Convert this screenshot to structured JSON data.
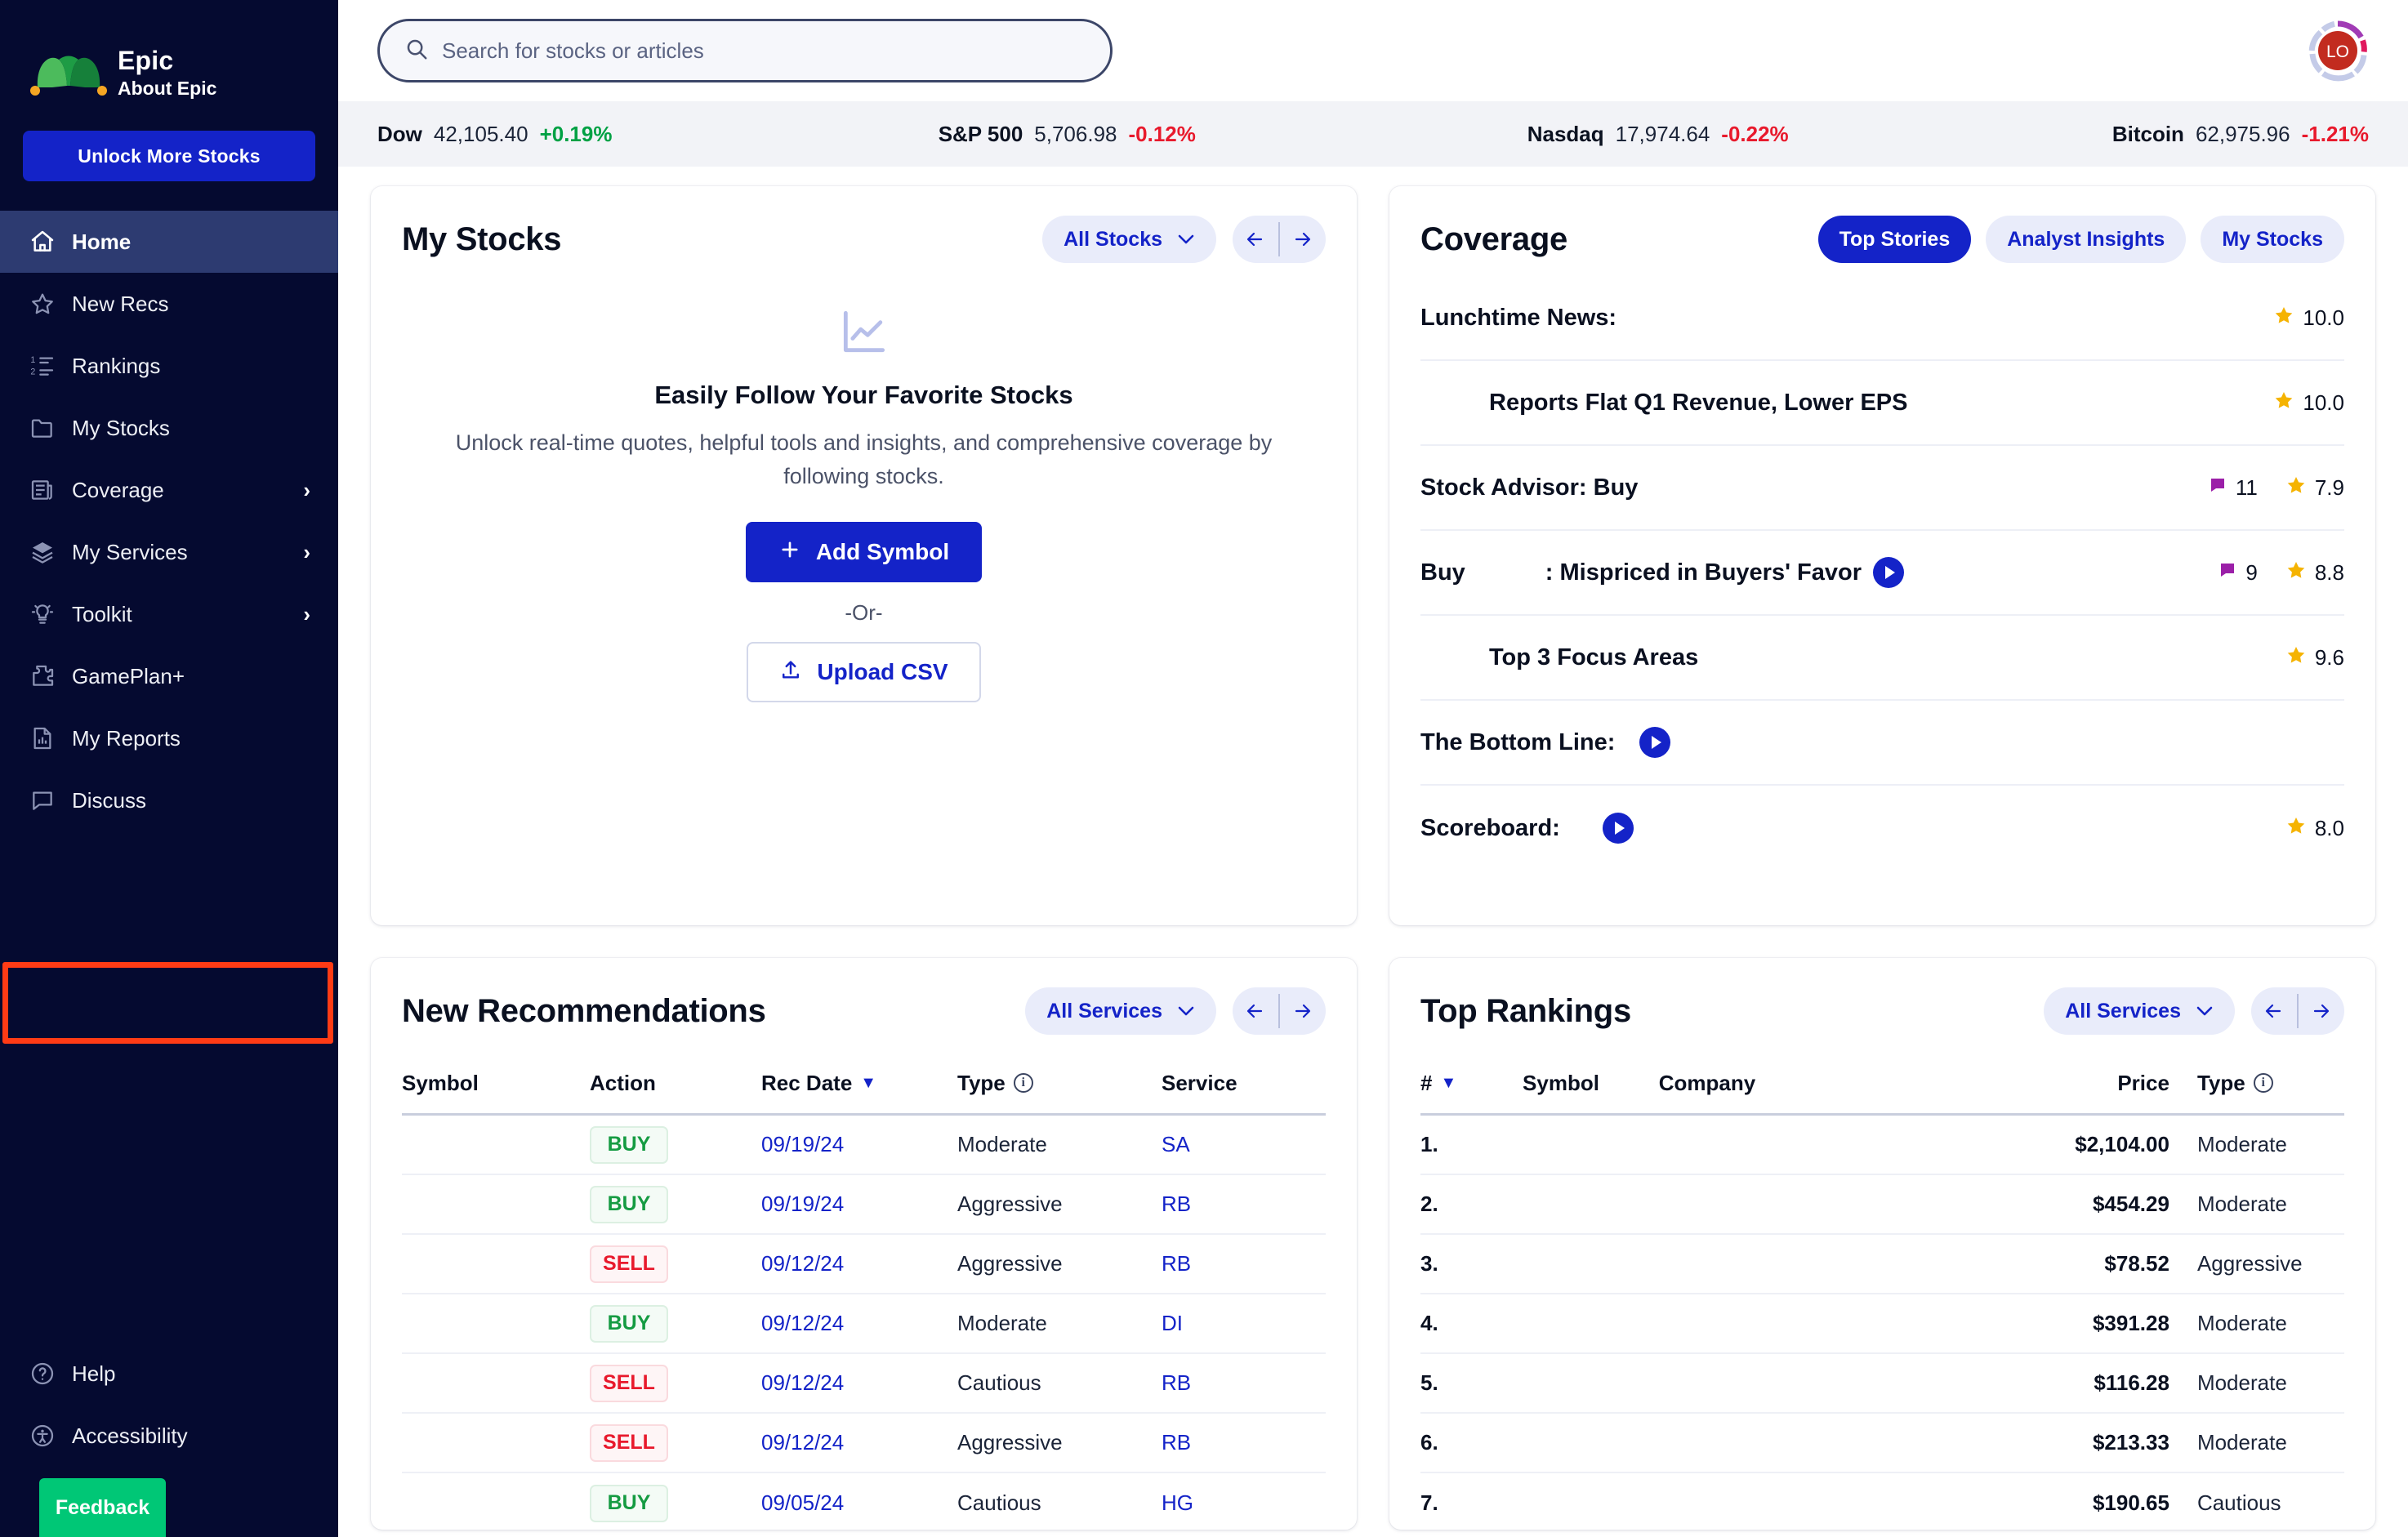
{
  "brand": {
    "title": "Epic",
    "subtitle": "About Epic",
    "logo_icon": "jester-hat-logo"
  },
  "sidebar": {
    "unlock_label": "Unlock More Stocks",
    "feedback_label": "Feedback",
    "items": [
      {
        "label": "Home",
        "icon": "home-icon",
        "active": true,
        "chevron": false
      },
      {
        "label": "New Recs",
        "icon": "star-icon",
        "active": false,
        "chevron": false
      },
      {
        "label": "Rankings",
        "icon": "ordered-list-icon",
        "active": false,
        "chevron": false
      },
      {
        "label": "My Stocks",
        "icon": "folder-icon",
        "active": false,
        "chevron": false
      },
      {
        "label": "Coverage",
        "icon": "news-icon",
        "active": false,
        "chevron": true
      },
      {
        "label": "My Services",
        "icon": "layers-icon",
        "active": false,
        "chevron": true
      },
      {
        "label": "Toolkit",
        "icon": "lightbulb-icon",
        "active": false,
        "chevron": true
      },
      {
        "label": "GamePlan+",
        "icon": "puzzle-icon",
        "active": false,
        "chevron": false
      },
      {
        "label": "My Reports",
        "icon": "report-icon",
        "active": false,
        "chevron": false
      },
      {
        "label": "Discuss",
        "icon": "chat-icon",
        "active": false,
        "chevron": false
      }
    ],
    "bottom_items": [
      {
        "label": "Help",
        "icon": "question-circle-icon"
      },
      {
        "label": "Accessibility",
        "icon": "accessibility-icon"
      }
    ],
    "highlight_target": "My Services",
    "highlight_color": "#FF3B15"
  },
  "topbar": {
    "search_placeholder": "Search for stocks or articles",
    "search_value": "",
    "avatar_initials": "LO"
  },
  "ticker": [
    {
      "name": "Dow",
      "value": "42,105.40",
      "change": "+0.19%",
      "dir": "up"
    },
    {
      "name": "S&P 500",
      "value": "5,706.98",
      "change": "-0.12%",
      "dir": "down"
    },
    {
      "name": "Nasdaq",
      "value": "17,974.64",
      "change": "-0.22%",
      "dir": "down"
    },
    {
      "name": "Bitcoin",
      "value": "62,975.96",
      "change": "-1.21%",
      "dir": "down"
    }
  ],
  "my_stocks": {
    "title": "My Stocks",
    "filter_label": "All Stocks",
    "empty_title": "Easily Follow Your Favorite Stocks",
    "empty_desc": "Unlock real-time quotes, helpful tools and insights, and comprehensive coverage by following stocks.",
    "add_symbol_label": "Add Symbol",
    "or_label": "-Or-",
    "upload_label": "Upload CSV"
  },
  "coverage": {
    "title": "Coverage",
    "tabs": [
      {
        "label": "Top Stories",
        "active": true
      },
      {
        "label": "Analyst Insights",
        "active": false
      },
      {
        "label": "My Stocks",
        "active": false
      }
    ],
    "rows": [
      {
        "label": "Lunchtime News:",
        "mid": "",
        "indent": false,
        "play": false,
        "comments": "",
        "rating": "10.0"
      },
      {
        "label": "",
        "mid": "Reports Flat Q1 Revenue, Lower EPS",
        "indent": true,
        "play": false,
        "comments": "",
        "rating": "10.0"
      },
      {
        "label": "Stock Advisor: Buy",
        "mid": "",
        "indent": false,
        "play": false,
        "comments": "11",
        "rating": "7.9"
      },
      {
        "label": "Buy",
        "mid": ": Mispriced in Buyers' Favor",
        "indent": false,
        "play": true,
        "comments": "9",
        "rating": "8.8"
      },
      {
        "label": "",
        "mid": "Top 3 Focus Areas",
        "indent": true,
        "play": false,
        "comments": "",
        "rating": "9.6"
      },
      {
        "label": "The Bottom Line:",
        "mid": "",
        "indent": false,
        "play": true,
        "comments": "",
        "rating": ""
      },
      {
        "label": "Scoreboard:",
        "mid": "",
        "indent": false,
        "play": true,
        "comments": "",
        "rating": "8.0"
      }
    ]
  },
  "new_recommendations": {
    "title": "New Recommendations",
    "filter_label": "All Services",
    "columns": [
      "Symbol",
      "Action",
      "Rec Date",
      "Type",
      "Service"
    ],
    "sorted_column": "Rec Date",
    "rows": [
      {
        "symbol": "",
        "action": "BUY",
        "date": "09/19/24",
        "type": "Moderate",
        "service": "SA"
      },
      {
        "symbol": "",
        "action": "BUY",
        "date": "09/19/24",
        "type": "Aggressive",
        "service": "RB"
      },
      {
        "symbol": "",
        "action": "SELL",
        "date": "09/12/24",
        "type": "Aggressive",
        "service": "RB"
      },
      {
        "symbol": "",
        "action": "BUY",
        "date": "09/12/24",
        "type": "Moderate",
        "service": "DI"
      },
      {
        "symbol": "",
        "action": "SELL",
        "date": "09/12/24",
        "type": "Cautious",
        "service": "RB"
      },
      {
        "symbol": "",
        "action": "SELL",
        "date": "09/12/24",
        "type": "Aggressive",
        "service": "RB"
      },
      {
        "symbol": "",
        "action": "BUY",
        "date": "09/05/24",
        "type": "Cautious",
        "service": "HG"
      }
    ]
  },
  "top_rankings": {
    "title": "Top Rankings",
    "filter_label": "All Services",
    "columns": [
      "#",
      "Symbol",
      "Company",
      "Price",
      "Type"
    ],
    "sorted_column": "#",
    "rows": [
      {
        "rank": "1.",
        "symbol": "",
        "company": "",
        "price": "$2,104.00",
        "type": "Moderate"
      },
      {
        "rank": "2.",
        "symbol": "",
        "company": "",
        "price": "$454.29",
        "type": "Moderate"
      },
      {
        "rank": "3.",
        "symbol": "",
        "company": "",
        "price": "$78.52",
        "type": "Aggressive"
      },
      {
        "rank": "4.",
        "symbol": "",
        "company": "",
        "price": "$391.28",
        "type": "Moderate"
      },
      {
        "rank": "5.",
        "symbol": "",
        "company": "",
        "price": "$116.28",
        "type": "Moderate"
      },
      {
        "rank": "6.",
        "symbol": "",
        "company": "",
        "price": "$213.33",
        "type": "Moderate"
      },
      {
        "rank": "7.",
        "symbol": "",
        "company": "",
        "price": "$190.65",
        "type": "Cautious"
      }
    ]
  },
  "colors": {
    "sidebar_bg": "#050A30",
    "accent": "#1423C8",
    "active_nav": "#2D3B71",
    "up": "#00A144",
    "down": "#E8192C",
    "feedback": "#00C776",
    "highlight": "#FF3B15",
    "star": "#F5B301",
    "comment": "#9B1FA8"
  }
}
